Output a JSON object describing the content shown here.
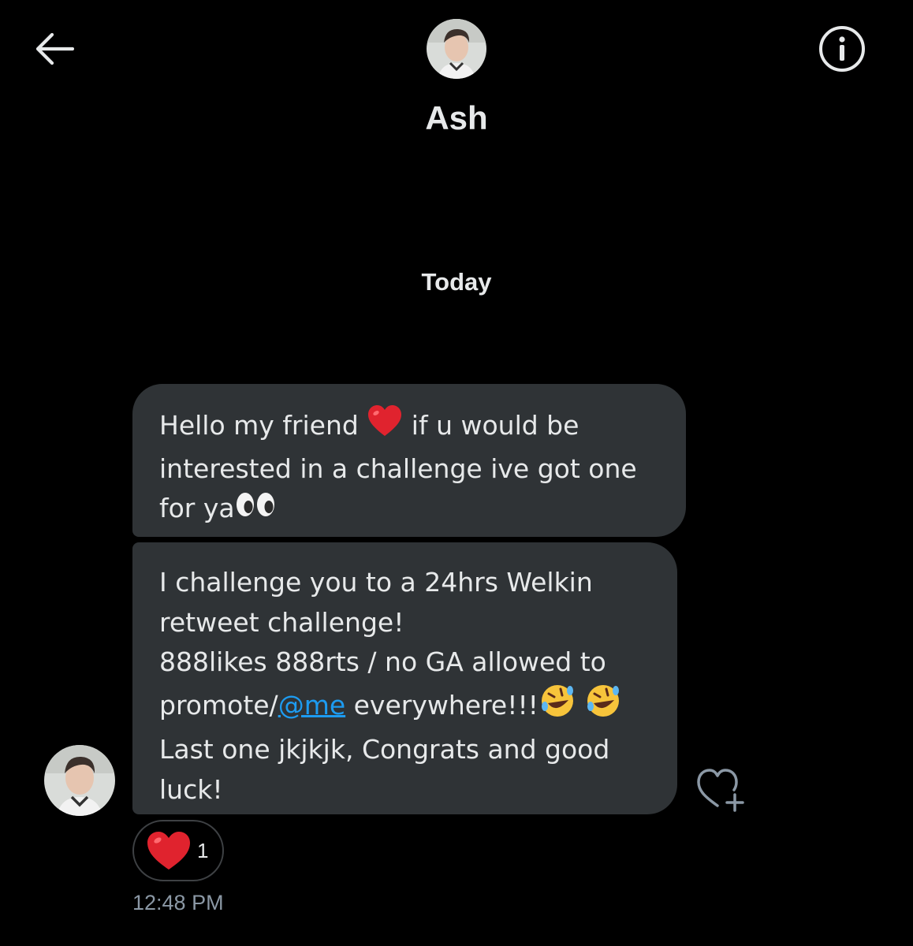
{
  "header": {
    "back_icon": "arrow-left-icon",
    "info_icon": "info-circle-icon",
    "contact_name": "Ash"
  },
  "conversation": {
    "date_divider": "Today",
    "messages": [
      {
        "line1_before": "Hello my friend ",
        "line1_after": " if u would be",
        "line2": "interested in a challenge ive got one",
        "line3": "for ya",
        "emojis": [
          "red-heart-emoji",
          "eyes-emoji"
        ]
      },
      {
        "line1": "I challenge you to a 24hrs Welkin",
        "line2": "retweet challenge!",
        "line3": "888likes 888rts / no GA allowed to",
        "line4_before": "promote/",
        "mention": "@me",
        "line4_after": " everywhere!!!",
        "line5": "Last one jkjkjk, Congrats and good",
        "line6": "luck!",
        "emojis": [
          "rolling-on-floor-laughing-emoji",
          "rolling-on-floor-laughing-emoji"
        ]
      }
    ],
    "reaction": {
      "icon": "red-heart-icon",
      "count": "1"
    },
    "timestamp": "12:48 PM",
    "add_reaction_icon": "heart-plus-icon"
  },
  "colors": {
    "background": "#000000",
    "bubble": "#2f3336",
    "text": "#e7e9ea",
    "link": "#1d9bf0",
    "muted": "#8b98a5",
    "heart": "#f4212e"
  }
}
